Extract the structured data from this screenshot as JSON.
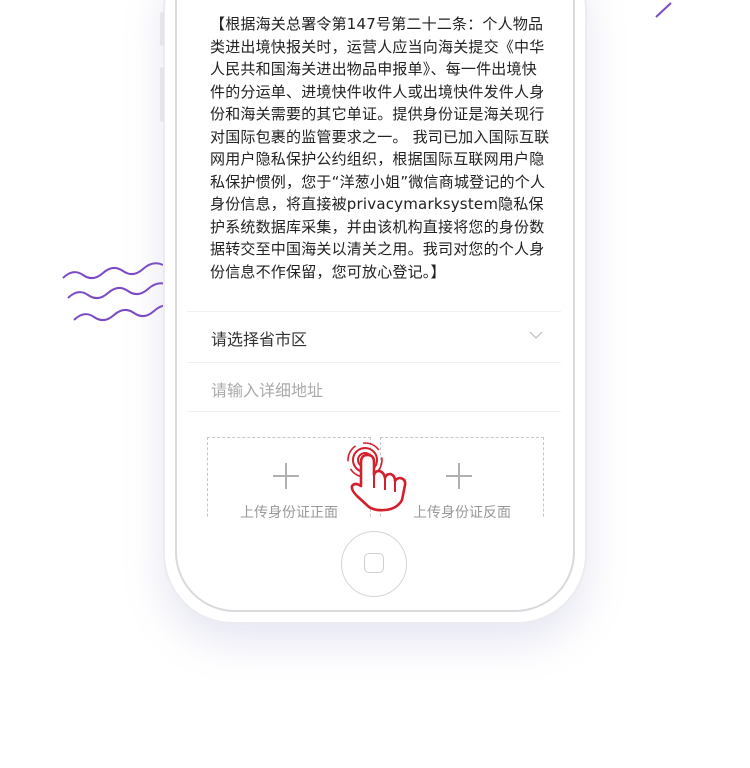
{
  "notice": {
    "text": "【根据海关总署令第147号第二十二条：个人物品类进出境快报关时，运营人应当向海关提交《中华人民共和国海关进出物品申报单》、每一件出境快件的分运单、进境快件收件人或出境快件发件人身份和海关需要的其它单证。提供身份证是海关现行对国际包裹的监管要求之一。 我司已加入国际互联网用户隐私保护公约组织，根据国际互联网用户隐私保护惯例，您于“洋葱小姐”微信商城登记的个人身份信息，将直接被privacymarksystem隐私保护系统数据库采集，并由该机构直接将您的身份数据转交至中国海关以清关之用。我司对您的个人身份信息不作保留，您可放心登记。】"
  },
  "form": {
    "region_label": "请选择省市区",
    "address_placeholder": "请输入详细地址"
  },
  "upload": {
    "front_label": "上传身份证正面",
    "back_label": "上传身份证反面"
  },
  "colors": {
    "accent_wave": "#7b4bc4",
    "hand": "#d4202c"
  }
}
